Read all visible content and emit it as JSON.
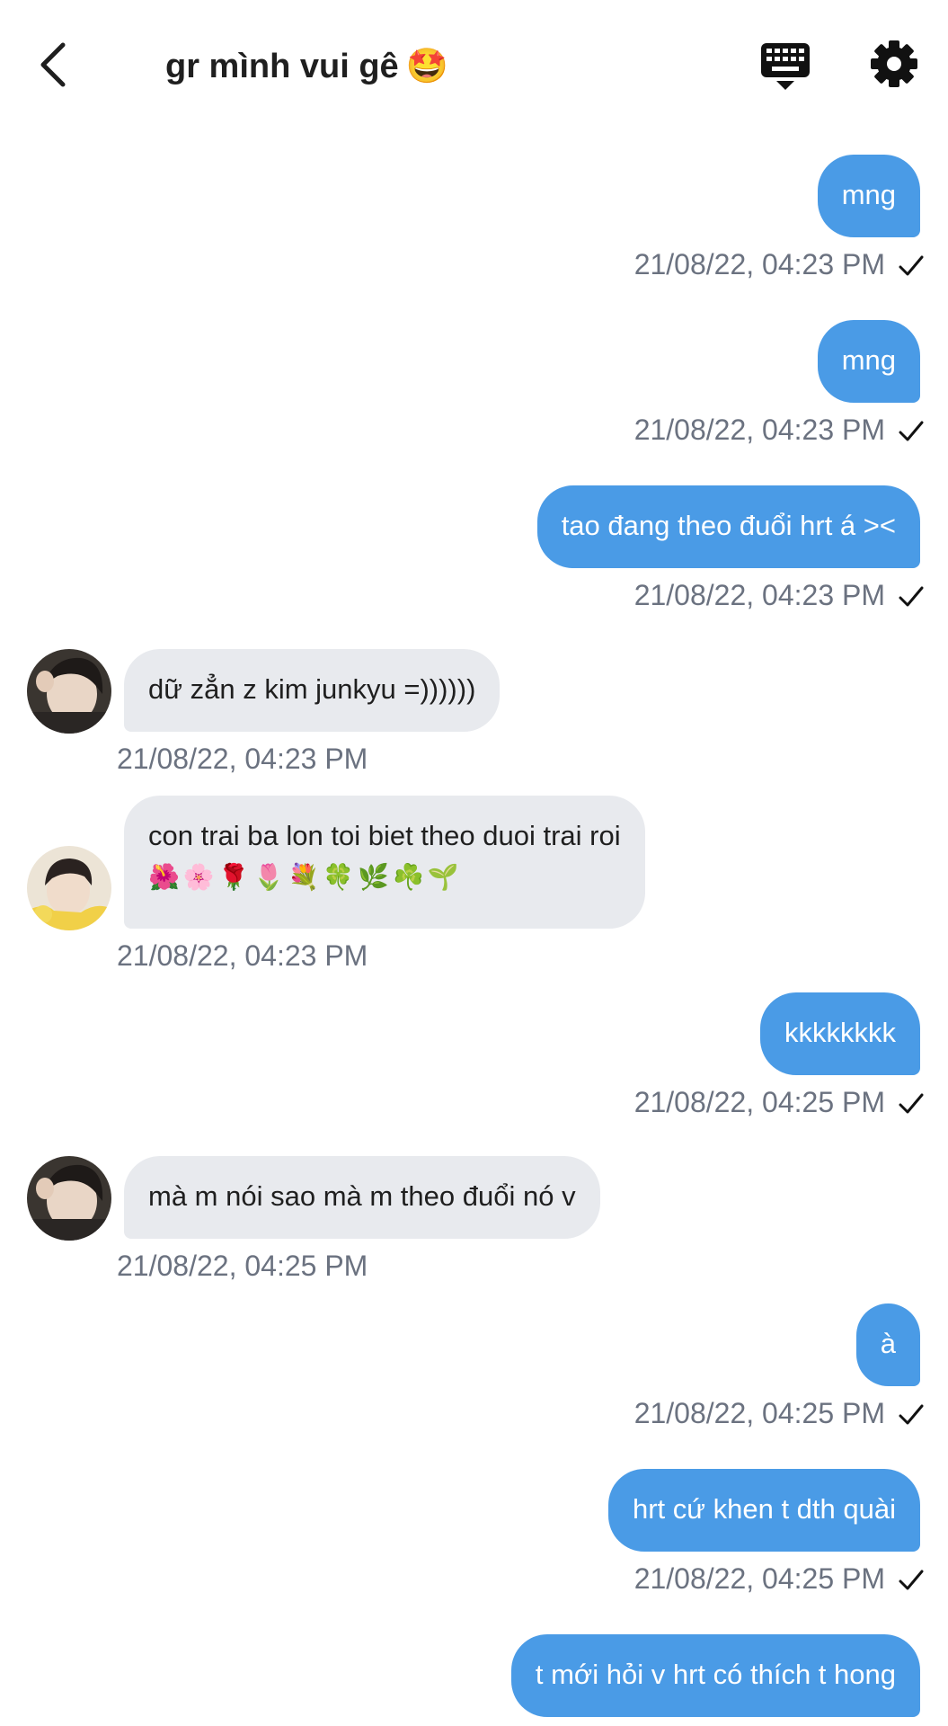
{
  "header": {
    "title": "gr mình vui gê",
    "title_emoji": "🤩",
    "back_icon": "chevron-left-icon",
    "keyboard_icon": "keyboard-icon",
    "settings_icon": "gear-icon"
  },
  "colors": {
    "outgoing_bubble": "#4a9be6",
    "incoming_bubble": "#e8eaee",
    "timestamp": "#6b7280"
  },
  "messages": [
    {
      "direction": "outgoing",
      "text": "mng",
      "time": "21/08/22, 04:23 PM",
      "read_icon": "check-icon"
    },
    {
      "direction": "outgoing",
      "text": "mng",
      "time": "21/08/22, 04:23 PM",
      "read_icon": "check-icon"
    },
    {
      "direction": "outgoing",
      "text": "tao đang theo đuổi hrt á ><",
      "time": "21/08/22, 04:23 PM",
      "read_icon": "check-icon"
    },
    {
      "direction": "incoming",
      "text": "dữ zẳn z kim junkyu =))))))",
      "time": "21/08/22, 04:23 PM",
      "avatar": "avatar-1"
    },
    {
      "direction": "incoming",
      "text": "con trai ba lon toi biet theo duoi trai roi",
      "text_line2": "🌺🌸🌹🌷💐🍀🌿☘️🌱",
      "time": "21/08/22, 04:23 PM",
      "avatar": "avatar-2"
    },
    {
      "direction": "outgoing",
      "text": "kkkkkkkk",
      "time": "21/08/22, 04:25 PM",
      "read_icon": "check-icon"
    },
    {
      "direction": "incoming",
      "text": "mà m nói sao mà m theo đuổi nó v",
      "time": "21/08/22, 04:25 PM",
      "avatar": "avatar-1"
    },
    {
      "direction": "outgoing",
      "text": "à",
      "time": "21/08/22, 04:25 PM",
      "read_icon": "check-icon"
    },
    {
      "direction": "outgoing",
      "text": "hrt cứ khen t dth quài",
      "time": "21/08/22, 04:25 PM",
      "read_icon": "check-icon"
    },
    {
      "direction": "outgoing",
      "text": "t mới hỏi v hrt có thích t hong",
      "time": "",
      "read_icon": ""
    }
  ]
}
